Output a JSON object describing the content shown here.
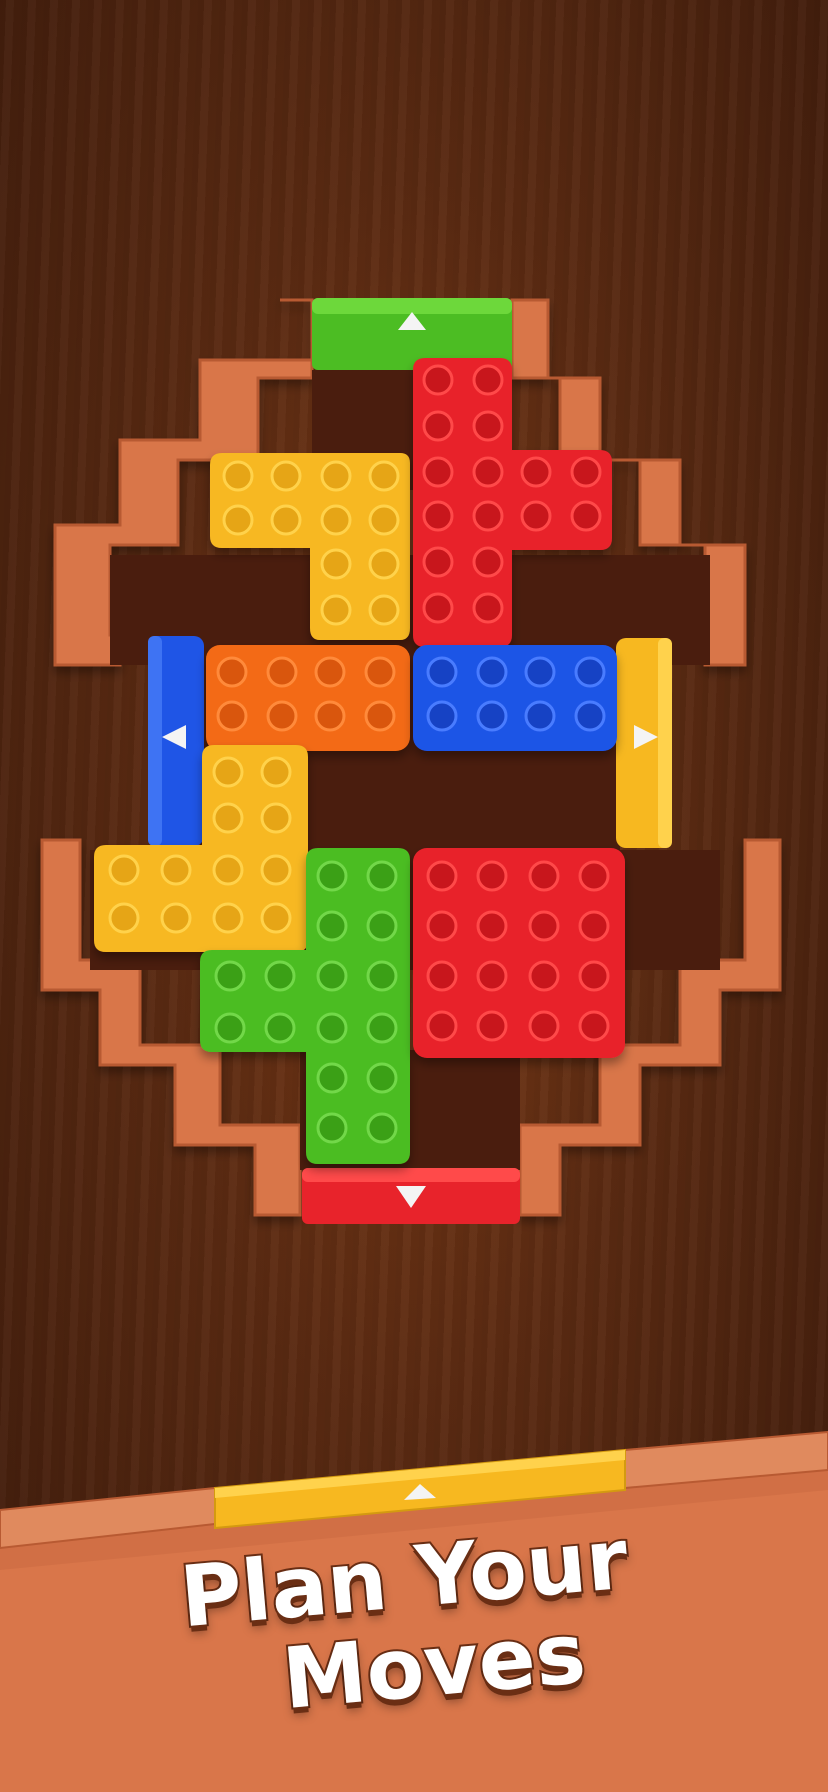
{
  "game": {
    "caption": {
      "line1": "Plan Your",
      "line2": "Moves"
    },
    "colors": {
      "red": "#e8232b",
      "yellow": "#f7b820",
      "orange": "#f36a12",
      "blue": "#1f55e6",
      "green": "#4cbd23",
      "board_frame": "#d9764a",
      "board_floor": "#4a1d0e"
    },
    "exit_gates": [
      {
        "name": "top-gate",
        "color": "green",
        "direction": "up"
      },
      {
        "name": "left-gate",
        "color": "blue",
        "direction": "left"
      },
      {
        "name": "right-gate",
        "color": "yellow",
        "direction": "right"
      },
      {
        "name": "bottom-gate",
        "color": "red",
        "direction": "down"
      },
      {
        "name": "shelf-gate",
        "color": "yellow",
        "direction": "up"
      }
    ],
    "blocks": [
      {
        "name": "yellow-t-block-top",
        "color": "yellow"
      },
      {
        "name": "red-cross-block",
        "color": "red"
      },
      {
        "name": "orange-bar-block",
        "color": "orange"
      },
      {
        "name": "blue-bar-block",
        "color": "blue"
      },
      {
        "name": "yellow-l-block-bottom",
        "color": "yellow"
      },
      {
        "name": "green-t-block",
        "color": "green"
      },
      {
        "name": "red-square-block",
        "color": "red"
      }
    ]
  }
}
